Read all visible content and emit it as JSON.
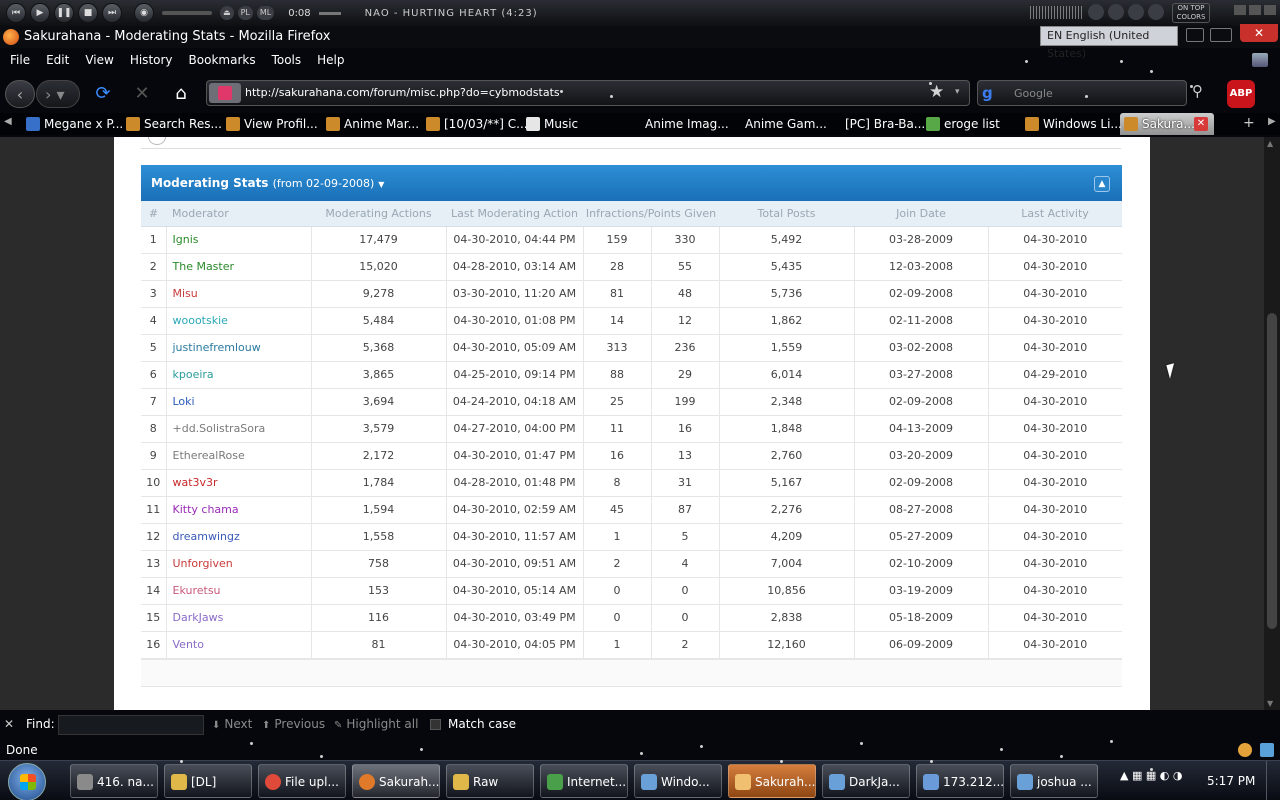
{
  "player": {
    "time": "0:08",
    "track": "NAO - HURTING HEART (4:23)",
    "mini_buttons": [
      "PL",
      "ML"
    ],
    "ontop_label": "ON TOP",
    "colors_label": "COLORS"
  },
  "window": {
    "title": "Sakurahana - Moderating Stats - Mozilla Firefox",
    "language": "EN English (United States)"
  },
  "menu": [
    "File",
    "Edit",
    "View",
    "History",
    "Bookmarks",
    "Tools",
    "Help"
  ],
  "nav": {
    "url": "http://sakurahana.com/forum/misc.php?do=cybmodstats",
    "search_placeholder": "Google",
    "abp_label": "ABP"
  },
  "bookmarks": [
    {
      "label": "Megane x P..."
    },
    {
      "label": "Search Res..."
    },
    {
      "label": "View Profil..."
    },
    {
      "label": "Anime Mar..."
    },
    {
      "label": "[10/03/**] C..."
    },
    {
      "label": "Music"
    },
    {
      "label": "Anime Imag..."
    },
    {
      "label": "Anime Gam..."
    },
    {
      "label": "[PC] Bra-Ba..."
    },
    {
      "label": "eroge list"
    },
    {
      "label": "Windows Li..."
    }
  ],
  "active_tab": "Sakura...",
  "stats": {
    "title": "Moderating Stats",
    "date_range": "(from 02-09-2008)",
    "columns": [
      "#",
      "Moderator",
      "Moderating Actions",
      "Last Moderating Action",
      "Infractions/Points Given",
      "Total Posts",
      "Join Date",
      "Last Activity"
    ],
    "rows": [
      {
        "n": "1",
        "name": "Ignis",
        "color": "#2a8a2a",
        "actions": "17,479",
        "last": "04-30-2010, 04:44 PM",
        "inf": "159",
        "pts": "330",
        "posts": "5,492",
        "join": "03-28-2009",
        "activity": "04-30-2010"
      },
      {
        "n": "2",
        "name": "The Master",
        "color": "#2a8a2a",
        "actions": "15,020",
        "last": "04-28-2010, 03:14 AM",
        "inf": "28",
        "pts": "55",
        "posts": "5,435",
        "join": "12-03-2008",
        "activity": "04-30-2010"
      },
      {
        "n": "3",
        "name": "Misu",
        "color": "#c83a3a",
        "actions": "9,278",
        "last": "03-30-2010, 11:20 AM",
        "inf": "81",
        "pts": "48",
        "posts": "5,736",
        "join": "02-09-2008",
        "activity": "04-30-2010"
      },
      {
        "n": "4",
        "name": "woootskie",
        "color": "#2aa8b8",
        "actions": "5,484",
        "last": "04-30-2010, 01:08 PM",
        "inf": "14",
        "pts": "12",
        "posts": "1,862",
        "join": "02-11-2008",
        "activity": "04-30-2010"
      },
      {
        "n": "5",
        "name": "justinefremlouw",
        "color": "#2a7aa0",
        "actions": "5,368",
        "last": "04-30-2010, 05:09 AM",
        "inf": "313",
        "pts": "236",
        "posts": "1,559",
        "join": "03-02-2008",
        "activity": "04-30-2010"
      },
      {
        "n": "6",
        "name": "kpoeira",
        "color": "#2a9a9a",
        "actions": "3,865",
        "last": "04-25-2010, 09:14 PM",
        "inf": "88",
        "pts": "29",
        "posts": "6,014",
        "join": "03-27-2008",
        "activity": "04-29-2010"
      },
      {
        "n": "7",
        "name": "Loki",
        "color": "#2a5ab8",
        "actions": "3,694",
        "last": "04-24-2010, 04:18 AM",
        "inf": "25",
        "pts": "199",
        "posts": "2,348",
        "join": "02-09-2008",
        "activity": "04-30-2010"
      },
      {
        "n": "8",
        "name": "+dd.SolistraSora",
        "color": "#7a7a7a",
        "actions": "3,579",
        "last": "04-27-2010, 04:00 PM",
        "inf": "11",
        "pts": "16",
        "posts": "1,848",
        "join": "04-13-2009",
        "activity": "04-30-2010"
      },
      {
        "n": "9",
        "name": "EtherealRose",
        "color": "#7a7a7a",
        "actions": "2,172",
        "last": "04-30-2010, 01:47 PM",
        "inf": "16",
        "pts": "13",
        "posts": "2,760",
        "join": "03-20-2009",
        "activity": "04-30-2010"
      },
      {
        "n": "10",
        "name": "wat3v3r",
        "color": "#c82a2a",
        "actions": "1,784",
        "last": "04-28-2010, 01:48 PM",
        "inf": "8",
        "pts": "31",
        "posts": "5,167",
        "join": "02-09-2008",
        "activity": "04-30-2010"
      },
      {
        "n": "11",
        "name": "Kitty chama",
        "color": "#9a2ab8",
        "actions": "1,594",
        "last": "04-30-2010, 02:59 AM",
        "inf": "45",
        "pts": "87",
        "posts": "2,276",
        "join": "08-27-2008",
        "activity": "04-30-2010"
      },
      {
        "n": "12",
        "name": "dreamwingz",
        "color": "#3a5ab8",
        "actions": "1,558",
        "last": "04-30-2010, 11:57 AM",
        "inf": "1",
        "pts": "5",
        "posts": "4,209",
        "join": "05-27-2009",
        "activity": "04-30-2010"
      },
      {
        "n": "13",
        "name": "Unforgiven",
        "color": "#c83a3a",
        "actions": "758",
        "last": "04-30-2010, 09:51 AM",
        "inf": "2",
        "pts": "4",
        "posts": "7,004",
        "join": "02-10-2009",
        "activity": "04-30-2010"
      },
      {
        "n": "14",
        "name": "Ekuretsu",
        "color": "#c85a7a",
        "actions": "153",
        "last": "04-30-2010, 05:14 AM",
        "inf": "0",
        "pts": "0",
        "posts": "10,856",
        "join": "03-19-2009",
        "activity": "04-30-2010"
      },
      {
        "n": "15",
        "name": "DarkJaws",
        "color": "#8a6ac8",
        "actions": "116",
        "last": "04-30-2010, 03:49 PM",
        "inf": "0",
        "pts": "0",
        "posts": "2,838",
        "join": "05-18-2009",
        "activity": "04-30-2010"
      },
      {
        "n": "16",
        "name": "Vento",
        "color": "#8a6ac8",
        "actions": "81",
        "last": "04-30-2010, 04:05 PM",
        "inf": "1",
        "pts": "2",
        "posts": "12,160",
        "join": "06-09-2009",
        "activity": "04-30-2010"
      }
    ]
  },
  "findbar": {
    "label": "Find:",
    "next": "Next",
    "previous": "Previous",
    "highlight": "Highlight all",
    "match_case": "Match case"
  },
  "status": "Done",
  "taskbar": {
    "tasks": [
      {
        "label": "416. na..."
      },
      {
        "label": "[DL]"
      },
      {
        "label": "File upl..."
      },
      {
        "label": "Sakurah..."
      },
      {
        "label": "Raw"
      },
      {
        "label": "Internet..."
      },
      {
        "label": "Windo..."
      },
      {
        "label": "Sakurah..."
      },
      {
        "label": "DarkJa..."
      },
      {
        "label": "173.212...."
      },
      {
        "label": "joshua ..."
      }
    ],
    "clock": "5:17 PM"
  }
}
